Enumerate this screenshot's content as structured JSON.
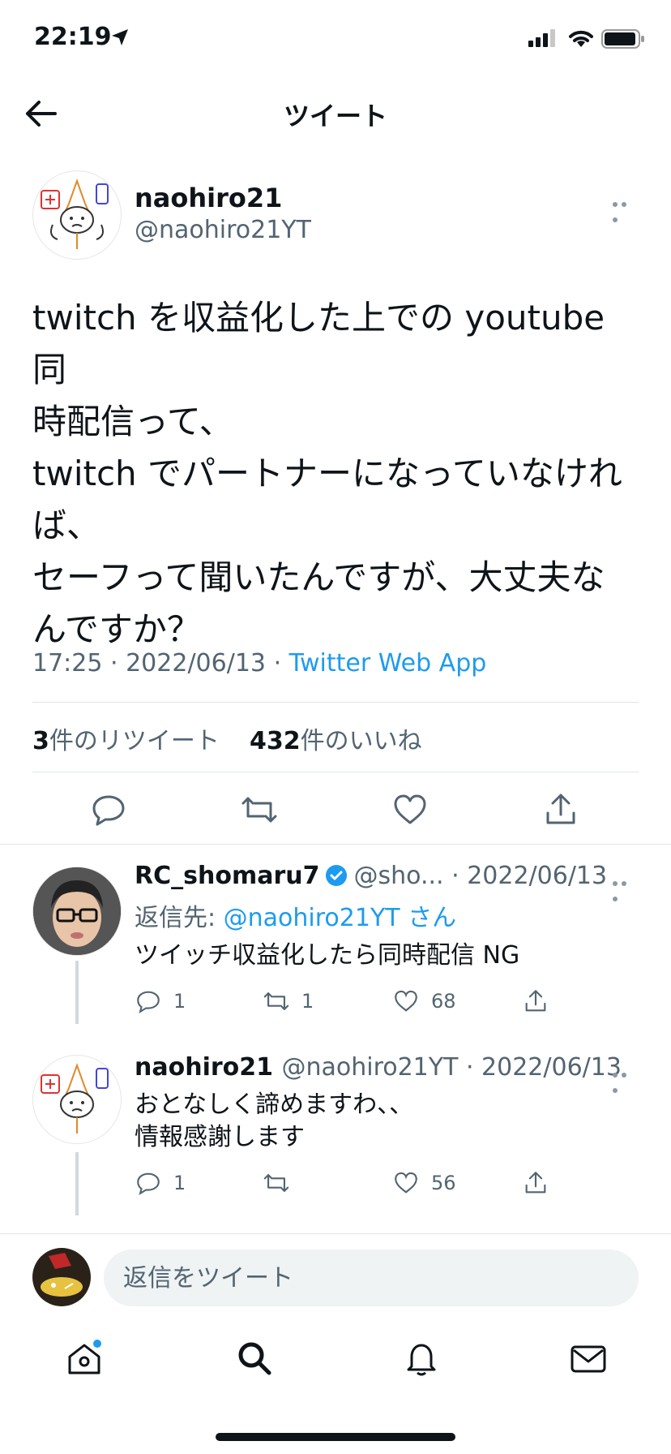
{
  "status_bar": {
    "time": "22:19"
  },
  "header": {
    "title": "ツイート"
  },
  "main_tweet": {
    "display_name": "naohiro21",
    "handle": "@naohiro21YT",
    "text": "twitch を収益化した上での youtube 同\n時配信って、\ntwitch でパートナーになっていなけれ\nば、\nセーフって聞いたんですが、大丈夫な\nんですか？",
    "time": "17:25",
    "date": "2022/06/13",
    "source": "Twitter Web App",
    "retweet_count": "3",
    "retweet_label": "件のリツイート",
    "like_count": "432",
    "like_label": "件のいいね"
  },
  "replies": [
    {
      "display_name": "RC_shomaru7",
      "handle": "@sho...",
      "date": "2022/06/13",
      "reply_to_label": "返信先:",
      "reply_to_mention": "@naohiro21YT さん",
      "text": "ツイッチ収益化したら同時配信 NG",
      "replies": "1",
      "retweets": "1",
      "likes": "68"
    },
    {
      "display_name": "naohiro21",
      "handle": "@naohiro21YT",
      "date": "2022/06/13",
      "text": "おとなしく諦めますわ、、\n情報感謝します",
      "replies": "1",
      "retweets": "",
      "likes": "56"
    }
  ],
  "reply_bar": {
    "placeholder": "返信をツイート"
  },
  "colors": {
    "accent": "#1d9bf0",
    "text": "#0f1419",
    "muted": "#536471"
  },
  "icons": [
    "back-arrow-icon",
    "more-icon",
    "reply-icon",
    "retweet-icon",
    "like-icon",
    "share-icon",
    "verified-icon",
    "home-icon",
    "search-icon",
    "notifications-icon",
    "messages-icon"
  ]
}
